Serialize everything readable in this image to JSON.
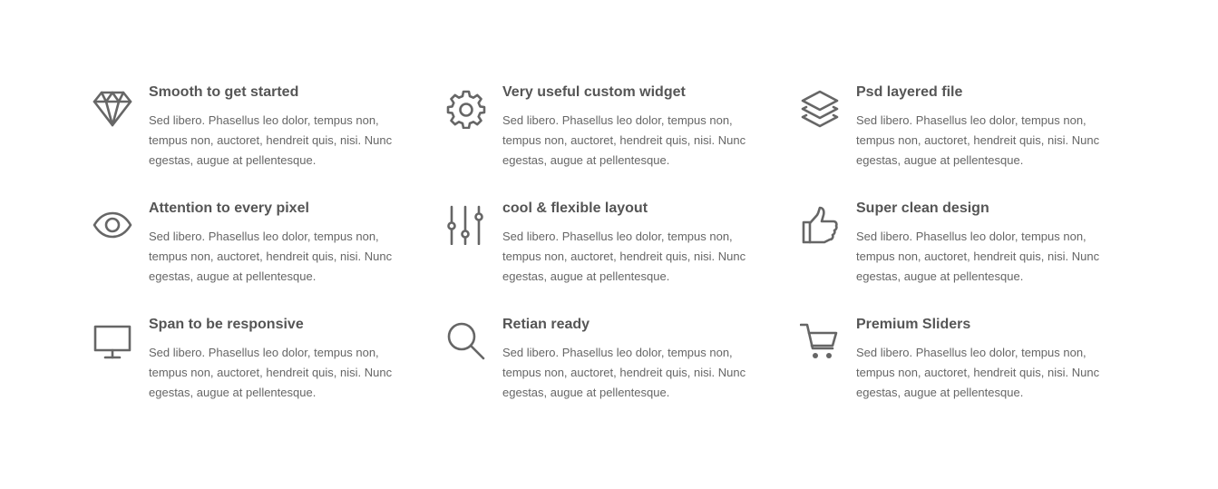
{
  "features": [
    {
      "icon": "diamond-icon",
      "title": "Smooth to get started",
      "description": "Sed libero. Phasellus leo dolor, tempus non, tempus non, auctoret, hendreit quis, nisi. Nunc egestas, augue at pellentesque."
    },
    {
      "icon": "gear-icon",
      "title": "Very useful custom widget",
      "description": "Sed libero. Phasellus leo dolor, tempus non, tempus non, auctoret, hendreit quis, nisi. Nunc egestas, augue at pellentesque."
    },
    {
      "icon": "layers-icon",
      "title": "Psd layered file",
      "description": "Sed libero. Phasellus leo dolor, tempus non, tempus non, auctoret, hendreit quis, nisi. Nunc egestas, augue at pellentesque."
    },
    {
      "icon": "eye-icon",
      "title": "Attention to every pixel",
      "description": "Sed libero. Phasellus leo dolor, tempus non, tempus non, auctoret, hendreit quis, nisi. Nunc egestas, augue at pellentesque."
    },
    {
      "icon": "sliders-icon",
      "title": "cool & flexible layout",
      "description": "Sed libero. Phasellus leo dolor, tempus non, tempus non, auctoret, hendreit quis, nisi. Nunc egestas, augue at pellentesque."
    },
    {
      "icon": "thumbs-up-icon",
      "title": "Super clean design",
      "description": "Sed libero. Phasellus leo dolor, tempus non, tempus non, auctoret, hendreit quis, nisi. Nunc egestas, augue at pellentesque."
    },
    {
      "icon": "monitor-icon",
      "title": "Span to be responsive",
      "description": "Sed libero. Phasellus leo dolor, tempus non, tempus non, auctoret, hendreit quis, nisi. Nunc egestas, augue at pellentesque."
    },
    {
      "icon": "search-icon",
      "title": "Retian ready",
      "description": "Sed libero. Phasellus leo dolor, tempus non, tempus non, auctoret, hendreit quis, nisi. Nunc egestas, augue at pellentesque."
    },
    {
      "icon": "shopping-cart-icon",
      "title": "Premium Sliders",
      "description": "Sed libero. Phasellus leo dolor, tempus non, tempus non, auctoret, hendreit quis, nisi. Nunc egestas, augue at pellentesque."
    }
  ],
  "colors": {
    "icon": "#666666",
    "title": "#555555",
    "text": "#666666",
    "background": "#ffffff"
  }
}
